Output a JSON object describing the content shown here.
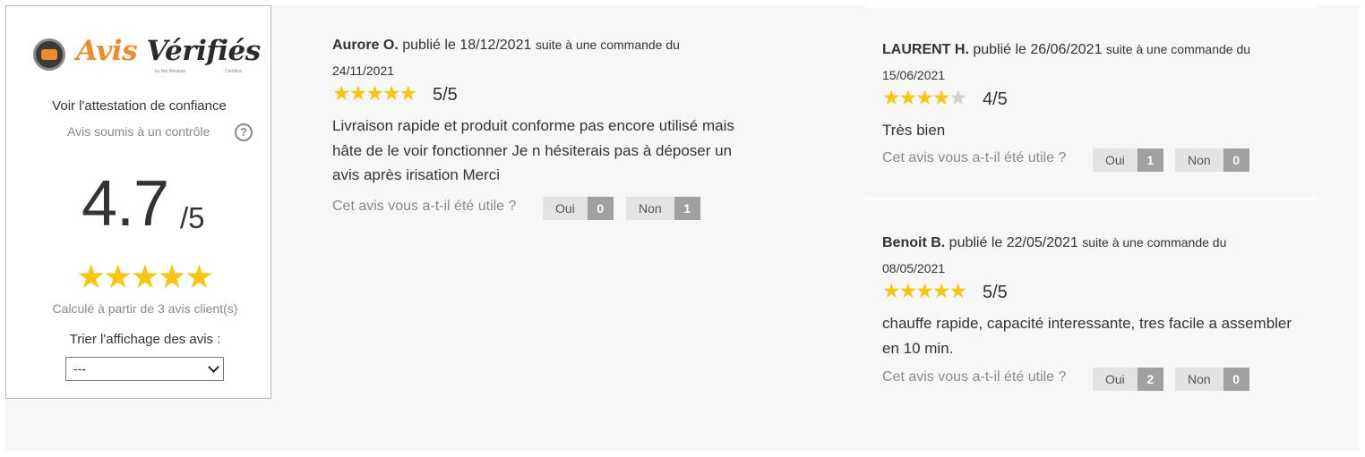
{
  "summary": {
    "logo": {
      "avis": "Avis",
      "verifies": "Vérifiés",
      "badge_text": "Avis Vérifiés",
      "subtitle": "by Net Reviews",
      "certified": "Certified"
    },
    "attestation_link": "Voir l'attestation de confiance",
    "control_text": "Avis soumis à un contrôle",
    "help_icon": "?",
    "score": "4.7",
    "score_max": "/5",
    "stars": 5,
    "calc_text": "Calculé à partir de 3 avis client(s)",
    "sort_label": "Trier l'affichage des avis :",
    "sort_selected": "---"
  },
  "reviews": [
    {
      "author": "Aurore O.",
      "published": "publié le 18/12/2021",
      "suite": "suite à une commande du",
      "order_date": "24/11/2021",
      "rating": 5,
      "score": "5/5",
      "text": "Livraison rapide et produit conforme pas encore utilisé mais hâte de le voir fonctionner Je n hésiterais pas à déposer un avis après irisation Merci",
      "useful_question": "Cet avis vous a-t-il été utile ?",
      "yes_label": "Oui",
      "yes_count": "0",
      "no_label": "Non",
      "no_count": "1"
    },
    {
      "author": "LAURENT H.",
      "published": "publié le 26/06/2021",
      "suite": "suite à une commande du",
      "order_date": "15/06/2021",
      "rating": 4,
      "score": "4/5",
      "text": "Très bien",
      "useful_question": "Cet avis vous a-t-il été utile ?",
      "yes_label": "Oui",
      "yes_count": "1",
      "no_label": "Non",
      "no_count": "0"
    },
    {
      "author": "Benoit B.",
      "published": "publié le 22/05/2021",
      "suite": "suite à une commande du",
      "order_date": "08/05/2021",
      "rating": 5,
      "score": "5/5",
      "text": "chauffe rapide, capacité interessante, tres facile a assembler en 10 min.",
      "useful_question": "Cet avis vous a-t-il été utile ?",
      "yes_label": "Oui",
      "yes_count": "2",
      "no_label": "Non",
      "no_count": "0"
    }
  ],
  "colors": {
    "star": "#f9c60b",
    "star_off": "#cfcfcf",
    "brand_orange": "#f08a24",
    "vote_count_bg": "#a0a0a0"
  }
}
